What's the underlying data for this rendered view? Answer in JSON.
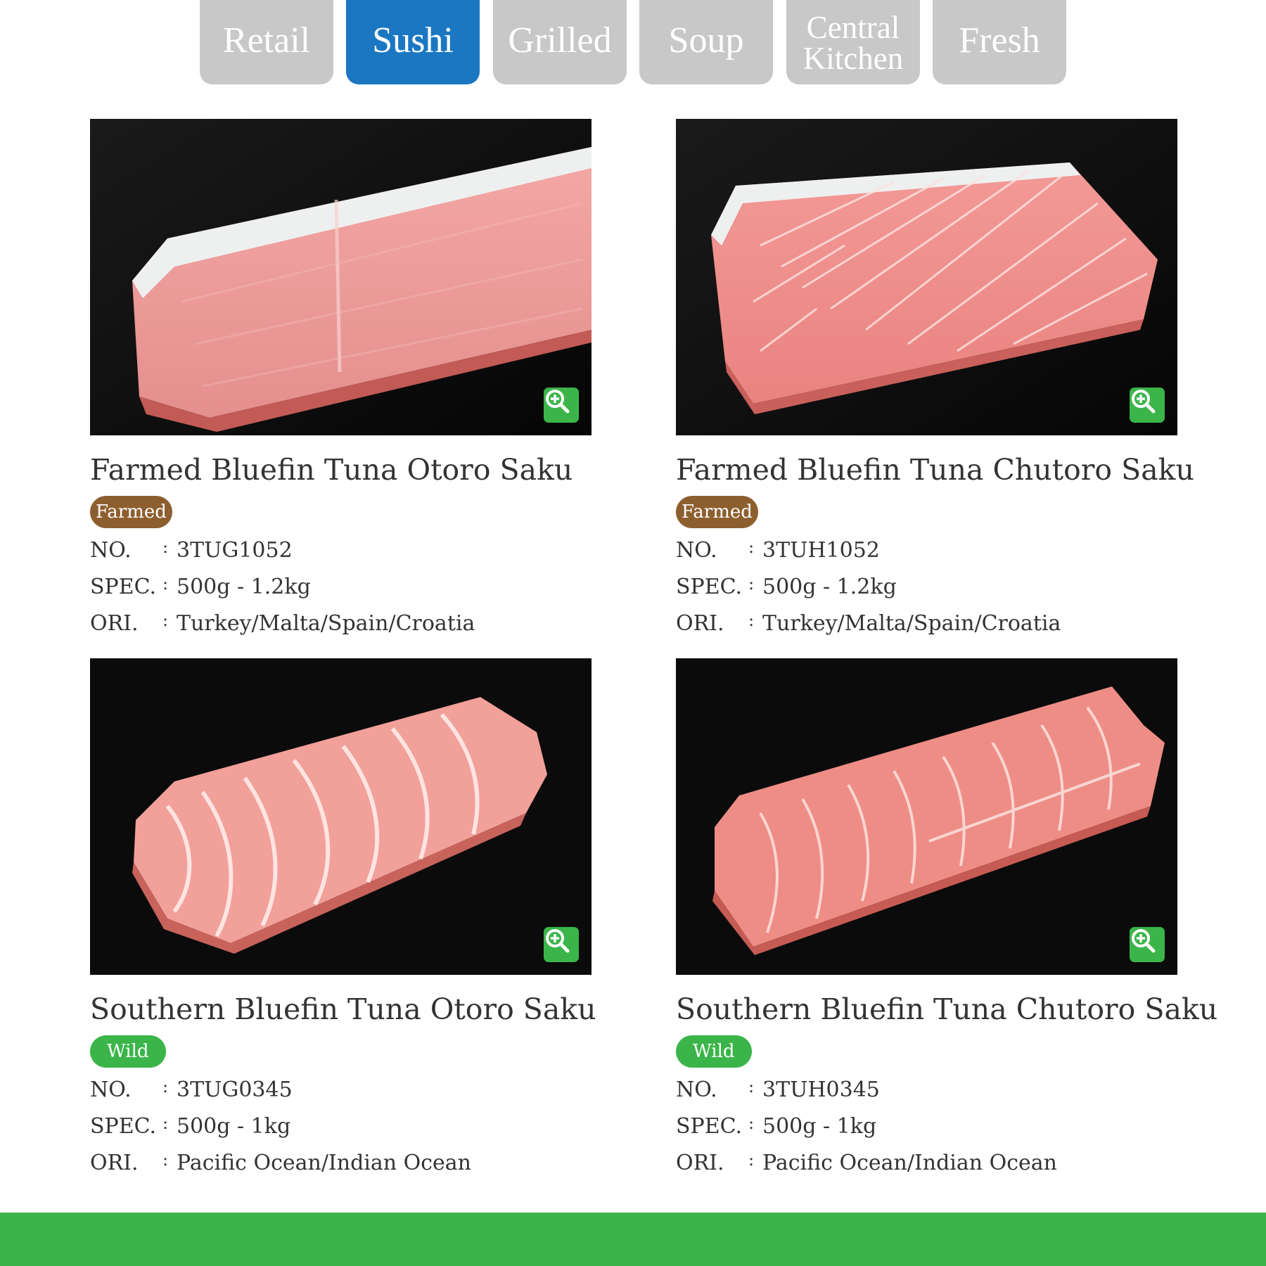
{
  "tabs": [
    {
      "label": "Retail",
      "active": false
    },
    {
      "label": "Sushi",
      "active": true
    },
    {
      "label": "Grilled",
      "active": false
    },
    {
      "label": "Soup",
      "active": false
    },
    {
      "label": "Central\nKitchen",
      "active": false
    },
    {
      "label": "Fresh",
      "active": false
    }
  ],
  "products": [
    {
      "title": "Farmed Bluefin Tuna Otoro Saku",
      "badge": "Farmed",
      "specs": [
        {
          "key": "NO.",
          "sep": ":",
          "value": "3TUG1052"
        },
        {
          "key": "SPEC.",
          "sep": ":",
          "value": "500g - 1.2kg"
        },
        {
          "key": "ORI.",
          "sep": ":",
          "value": "Turkey/Malta/Spain/Croatia"
        }
      ]
    },
    {
      "title": "Farmed Bluefin Tuna Chutoro Saku",
      "badge": "Farmed",
      "specs": [
        {
          "key": "NO.",
          "sep": ":",
          "value": "3TUH1052"
        },
        {
          "key": "SPEC.",
          "sep": ":",
          "value": "500g - 1.2kg"
        },
        {
          "key": "ORI.",
          "sep": ":",
          "value": "Turkey/Malta/Spain/Croatia"
        }
      ]
    },
    {
      "title": "Southern Bluefin Tuna Otoro Saku",
      "badge": "Wild",
      "specs": [
        {
          "key": "NO.",
          "sep": ":",
          "value": "3TUG0345"
        },
        {
          "key": "SPEC.",
          "sep": ":",
          "value": "500g - 1kg"
        },
        {
          "key": "ORI.",
          "sep": ":",
          "value": "Pacific Ocean/Indian Ocean"
        }
      ]
    },
    {
      "title": "Southern Bluefin Tuna Chutoro Saku",
      "badge": "Wild",
      "specs": [
        {
          "key": "NO.",
          "sep": ":",
          "value": "3TUH0345"
        },
        {
          "key": "SPEC.",
          "sep": ":",
          "value": "500g - 1kg"
        },
        {
          "key": "ORI.",
          "sep": ":",
          "value": "Pacific Ocean/Indian Ocean"
        }
      ]
    }
  ],
  "icons": {
    "zoom": "zoom-in-icon"
  },
  "colors": {
    "active_tab": "#1b77c2",
    "inactive_tab": "#c8c8c8",
    "farmed_badge": "#8d5f2f",
    "wild_badge": "#3bb54a",
    "footer": "#3bb54a"
  }
}
